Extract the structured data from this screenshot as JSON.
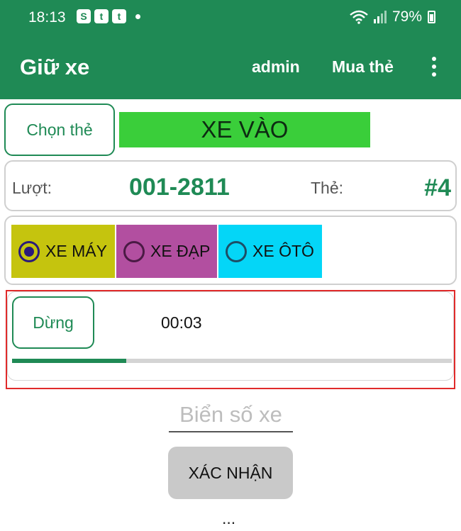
{
  "status_bar": {
    "time": "18:13",
    "notifications": [
      "S",
      "t",
      "t"
    ],
    "battery": "79%",
    "icons": [
      "wifi-icon",
      "signal-icon",
      "battery-icon"
    ]
  },
  "app_bar": {
    "title": "Giữ xe",
    "user": "admin",
    "buy_card": "Mua thẻ",
    "menu_icon": "more-vert-icon"
  },
  "card_select": {
    "button": "Chọn thẻ",
    "direction": "XE VÀO"
  },
  "turn_info": {
    "turn_label": "Lượt:",
    "turn_value": "001-2811",
    "card_label": "Thẻ:",
    "card_value": "#4"
  },
  "vehicle_types": [
    {
      "label": "XE MÁY",
      "selected": true,
      "color": "#c5c40e"
    },
    {
      "label": "XE ĐẠP",
      "selected": false,
      "color": "#b24fa0"
    },
    {
      "label": "XE ÔTÔ",
      "selected": false,
      "color": "#04d6f7"
    }
  ],
  "timer": {
    "stop_button": "Dừng",
    "elapsed": "00:03",
    "progress": 0.26
  },
  "plate": {
    "placeholder": "Biển số xe",
    "value": ""
  },
  "confirm_button": "XÁC NHẬN",
  "more_indicator": "...",
  "colors": {
    "primary": "#1f8a55",
    "direction_banner": "#3ace3a",
    "highlight_border": "#e02a2a"
  }
}
